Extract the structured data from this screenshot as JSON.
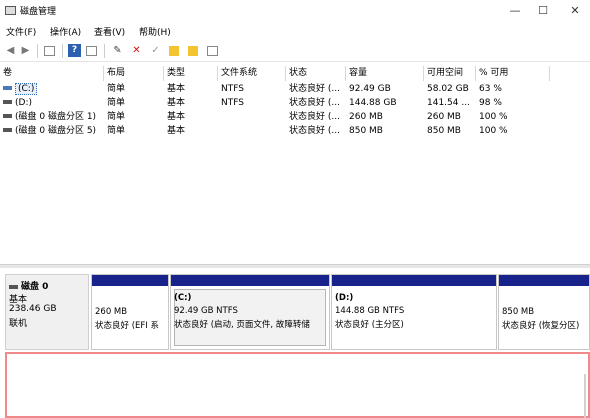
{
  "window": {
    "title": "磁盘管理",
    "minimize": "—",
    "maximize": "☐",
    "close": "✕"
  },
  "menu": [
    "文件(F)",
    "操作(A)",
    "查看(V)",
    "帮助(H)"
  ],
  "toolbar_icons": [
    "back-arrow-icon",
    "forward-arrow-icon",
    "properties-icon",
    "help-icon",
    "list-icon",
    "connect-icon",
    "delete-icon",
    "check-icon",
    "folder-icon",
    "folder-search-icon",
    "details-icon"
  ],
  "volume_list": {
    "columns": [
      "卷",
      "布局",
      "类型",
      "文件系统",
      "状态",
      "容量",
      "可用空间",
      "% 可用"
    ],
    "rows": [
      {
        "name": "(C:)",
        "layout": "简单",
        "type": "基本",
        "fs": "NTFS",
        "status": "状态良好 (...",
        "capacity": "92.49 GB",
        "free": "58.02 GB",
        "pct": "63 %"
      },
      {
        "name": "(D:)",
        "layout": "简单",
        "type": "基本",
        "fs": "NTFS",
        "status": "状态良好 (...",
        "capacity": "144.88 GB",
        "free": "141.54 ...",
        "pct": "98 %"
      },
      {
        "name": "(磁盘 0 磁盘分区 1)",
        "layout": "简单",
        "type": "基本",
        "fs": "",
        "status": "状态良好 (...",
        "capacity": "260 MB",
        "free": "260 MB",
        "pct": "100 %"
      },
      {
        "name": "(磁盘 0 磁盘分区 5)",
        "layout": "简单",
        "type": "基本",
        "fs": "",
        "status": "状态良好 (...",
        "capacity": "850 MB",
        "free": "850 MB",
        "pct": "100 %"
      }
    ]
  },
  "disk0": {
    "name": "磁盘 0",
    "type": "基本",
    "size": "238.46 GB",
    "status": "联机",
    "partitions": [
      {
        "title": "",
        "size": "260 MB",
        "status": "状态良好 (EFI 系"
      },
      {
        "title": "(C:)",
        "size": "92.49 GB NTFS",
        "status": "状态良好 (启动, 页面文件, 故障转储"
      },
      {
        "title": "(D:)",
        "size": "144.88 GB NTFS",
        "status": "状态良好 (主分区)"
      },
      {
        "title": "",
        "size": "850 MB",
        "status": "状态良好 (恢复分区)"
      }
    ]
  },
  "colors": {
    "band": "#17238a",
    "selection": "#e8f0fb",
    "bottom_border": "#f08a8a"
  }
}
